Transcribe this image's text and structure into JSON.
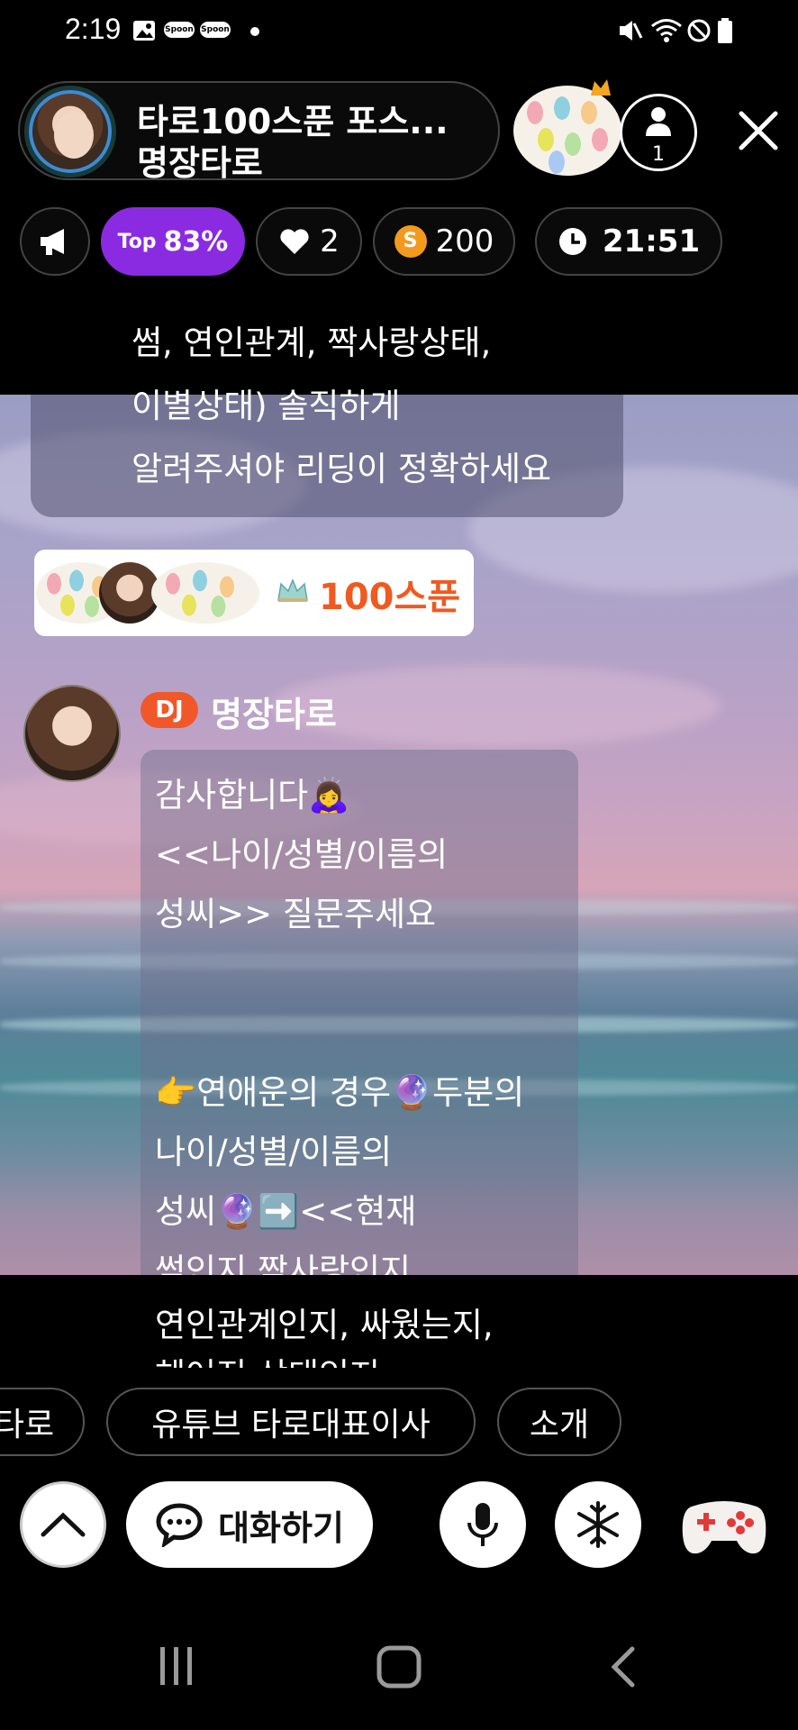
{
  "status_bar": {
    "time": "2:19",
    "notif_badge_1": "Spoon",
    "notif_badge_2": "Spoon"
  },
  "header": {
    "room_title": "타로100스푼 포스...",
    "host_name": "명장타로",
    "listener_count": "1"
  },
  "stats": {
    "top_prefix": "Top",
    "top_percent": "83%",
    "likes": "2",
    "coin_letter": "S",
    "spoons": "200",
    "timer": "21:51"
  },
  "messages": {
    "prev_lines": [
      "썸, 연인관계, 짝사랑상태,",
      "이별상태) 솔직하게",
      "알려주셔야 리딩이 정확하세요"
    ],
    "spoon_gift": "100스푼",
    "dj_badge": "DJ",
    "dj_name": "명장타로",
    "dj_lines": [
      "감사합니다🙇‍♀️",
      "<<나이/성별/이름의",
      "성씨>> 질문주세요",
      "",
      "",
      "👉연애운의 경우🔮두분의",
      "나이/성별/이름의",
      "성씨🔮➡️<<현재",
      "썸인지,짝사랑인지",
      "연인관계인지, 싸웠는지,",
      "헤어진 상태인지"
    ]
  },
  "chips": [
    "타로",
    "유튜브 타로대표이사",
    "소개"
  ],
  "bottom_bar": {
    "chat_label": "대화하기"
  },
  "colors": {
    "top_pill": "#8a2be2",
    "dj_badge": "#f0582a",
    "spoon_text": "#ef5a1f",
    "coin": "#f39a1e"
  }
}
